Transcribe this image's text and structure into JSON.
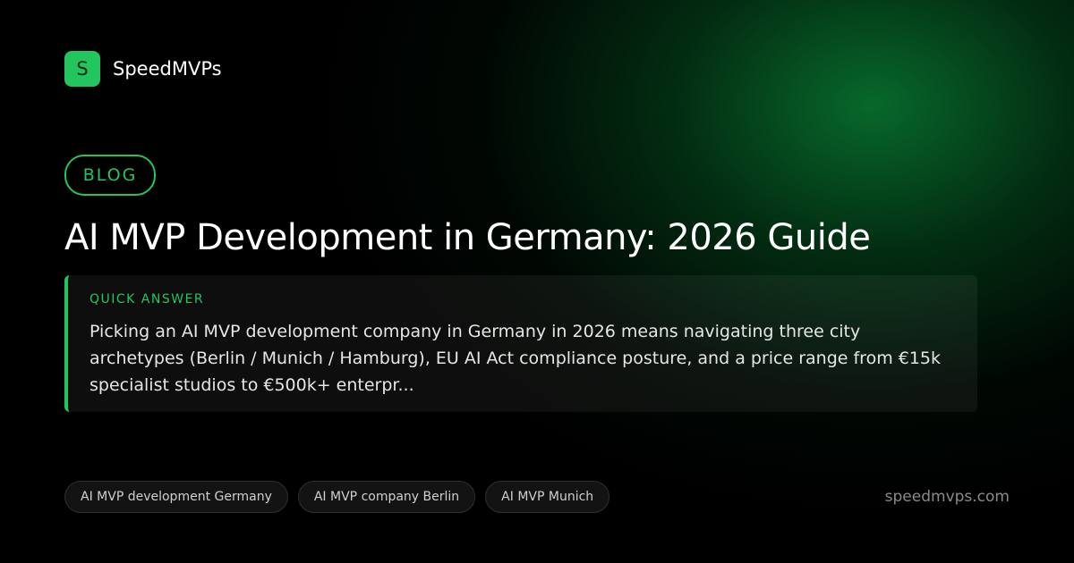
{
  "brand": {
    "logo_letter": "S",
    "name": "SpeedMVPs"
  },
  "badge": {
    "label": "BLOG"
  },
  "title": "AI MVP Development in Germany: 2026 Guide",
  "quick_answer": {
    "label": "QUICK ANSWER",
    "text": "Picking an AI MVP development company in Germany in 2026 means navigating three city archetypes (Berlin / Munich / Hamburg), EU AI Act compliance posture, and a price range from €15k specialist studios to €500k+ enterpr..."
  },
  "tags": [
    {
      "label": "AI MVP development Germany"
    },
    {
      "label": "AI MVP company Berlin"
    },
    {
      "label": "AI MVP Munich"
    }
  ],
  "footer": {
    "domain": "speedmvps.com"
  },
  "colors": {
    "accent": "#22c55e",
    "background": "#000000",
    "glow": "#086e2d"
  }
}
